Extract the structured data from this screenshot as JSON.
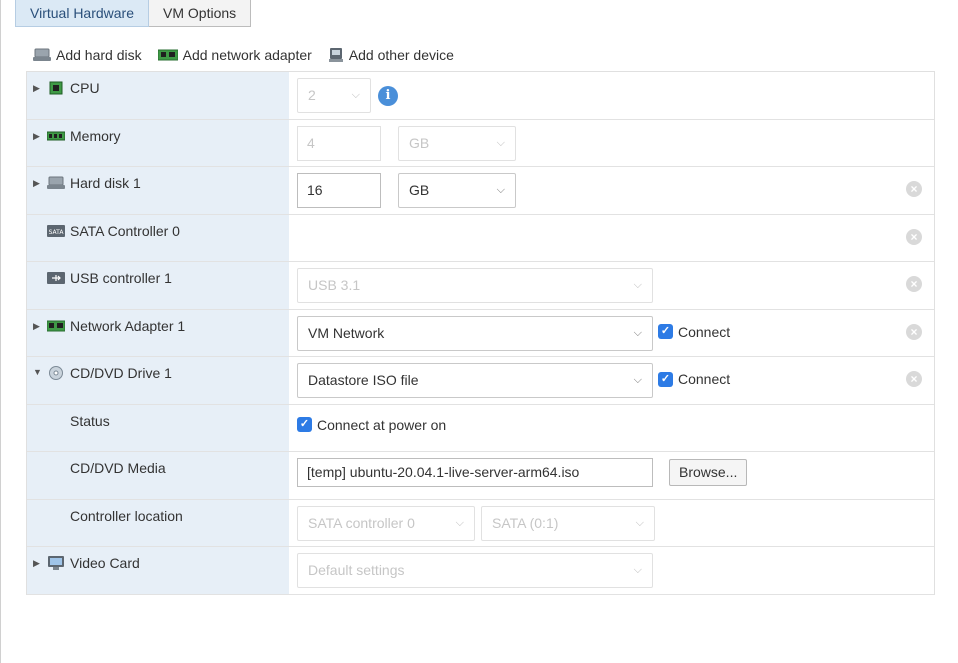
{
  "tabs": [
    {
      "label": "Virtual Hardware",
      "active": true
    },
    {
      "label": "VM Options",
      "active": false
    }
  ],
  "add_bar": {
    "hard_disk": "Add hard disk",
    "network": "Add network adapter",
    "other": "Add other device"
  },
  "rows": {
    "cpu": {
      "label": "CPU",
      "value": "2"
    },
    "memory": {
      "label": "Memory",
      "value": "4",
      "unit": "GB"
    },
    "hard_disk": {
      "label": "Hard disk 1",
      "value": "16",
      "unit": "GB"
    },
    "sata": {
      "label": "SATA Controller 0"
    },
    "usb": {
      "label": "USB controller 1",
      "value": "USB 3.1"
    },
    "network": {
      "label": "Network Adapter 1",
      "value": "VM Network",
      "connect": "Connect"
    },
    "cddvd": {
      "label": "CD/DVD Drive 1",
      "value": "Datastore ISO file",
      "connect": "Connect"
    },
    "status": {
      "label": "Status",
      "value": "Connect at power on"
    },
    "media": {
      "label": "CD/DVD Media",
      "value": "[temp] ubuntu-20.04.1-live-server-arm64.iso",
      "browse": "Browse..."
    },
    "controller_location": {
      "label": "Controller location",
      "controller": "SATA controller 0",
      "slot": "SATA (0:1)"
    },
    "video": {
      "label": "Video Card",
      "value": "Default settings"
    }
  },
  "icons": {
    "remove": "×",
    "info": "i",
    "checkmark": "✓",
    "chevron": "⌵"
  },
  "colors": {
    "tab_active_bg": "#dbe9f5",
    "label_column_bg": "#e7eff7",
    "checkbox": "#2d7be5",
    "info": "#4a8fd9"
  }
}
